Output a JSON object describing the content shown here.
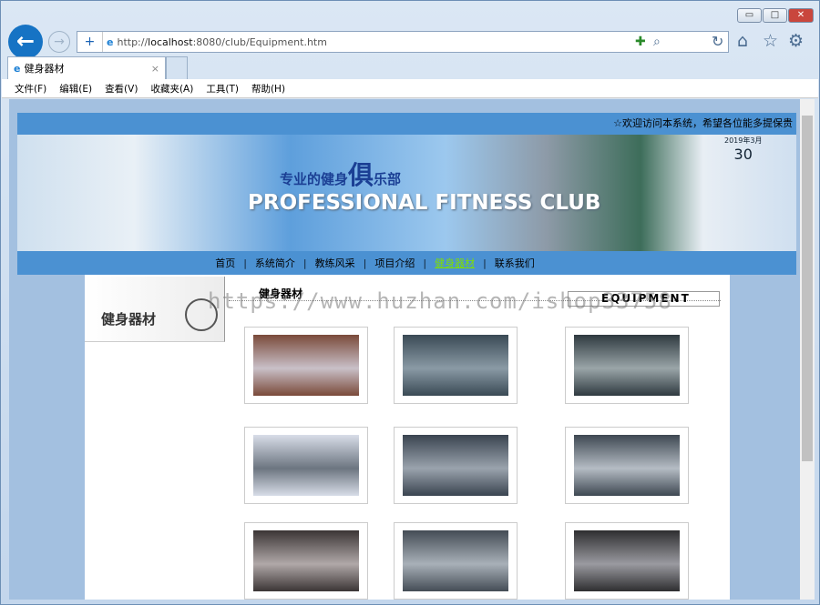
{
  "browser": {
    "url_prefix": "http://",
    "url_host": "localhost",
    "url_rest": ":8080/club/Equipment.htm",
    "tab_title": "健身器材",
    "tab_close": "×",
    "menu": [
      "文件(F)",
      "编辑(E)",
      "查看(V)",
      "收藏夹(A)",
      "工具(T)",
      "帮助(H)"
    ],
    "window_buttons": [
      "▭",
      "□",
      "✕"
    ]
  },
  "page": {
    "marquee": "☆欢迎访问本系统，希望各位能多提保贵",
    "banner": {
      "slogan_a": "专业的健身",
      "slogan_b": "俱",
      "slogan_c": "乐部",
      "english": "PROFESSIONAL FITNESS CLUB",
      "date_month": "2019年3月",
      "date_day": "30"
    },
    "nav": [
      {
        "label": "首页"
      },
      {
        "label": "系统简介"
      },
      {
        "label": "教练风采"
      },
      {
        "label": "项目介绍"
      },
      {
        "label": "健身器材",
        "active": true
      },
      {
        "label": "联系我们"
      }
    ],
    "sidebar_title": "健身器材",
    "content_title": "健身器材",
    "content_badge": "EQUIPMENT",
    "watermark": "https://www.huzhan.com/ishop33758",
    "photos": [
      "equipment-1",
      "equipment-2",
      "equipment-3",
      "equipment-4",
      "equipment-5",
      "equipment-6",
      "equipment-7",
      "equipment-8",
      "equipment-9"
    ]
  },
  "colors": {
    "bar": "#4b91d2",
    "nav_active": "#7fe000",
    "page_bg": "#a3c0e0"
  }
}
